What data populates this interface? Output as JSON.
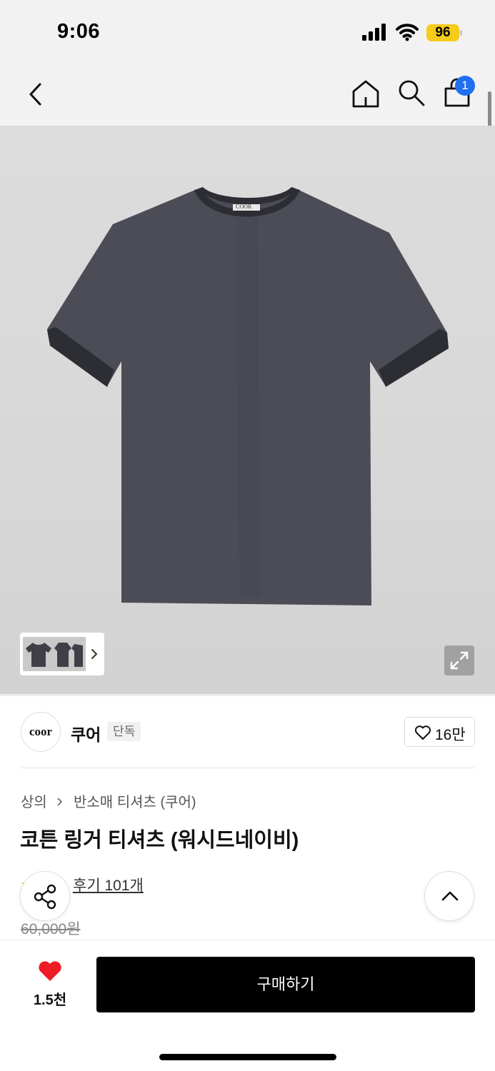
{
  "status_bar": {
    "time": "9:06",
    "battery": "96",
    "battery_color": "#f5cc1a"
  },
  "nav": {
    "back_icon": "chevron-left-icon",
    "home_icon": "home-icon",
    "search_icon": "search-icon",
    "cart_icon": "shopping-bag-icon",
    "cart_count": "1",
    "badge_color": "#1f6ff0"
  },
  "gallery": {
    "product_tag_text": "COOR",
    "thumbnail_count": 3,
    "expand_icon": "expand-icon"
  },
  "brand": {
    "logo_text": "coor",
    "name": "쿠어",
    "tag": "단독",
    "like_count": "16만"
  },
  "product": {
    "breadcrumb": [
      "상의",
      "반소매 티셔츠 (쿠어)"
    ],
    "title": "코튼 링거 티셔츠 (워시드네이비)",
    "review_link": "후기 101개",
    "original_price": "60,000원"
  },
  "floating": {
    "share_icon": "share-icon",
    "scroll_top_icon": "chevron-up-icon"
  },
  "bottom_bar": {
    "favorite_count": "1.5천",
    "favorite_color": "#ee1c25",
    "buy_label": "구매하기"
  }
}
